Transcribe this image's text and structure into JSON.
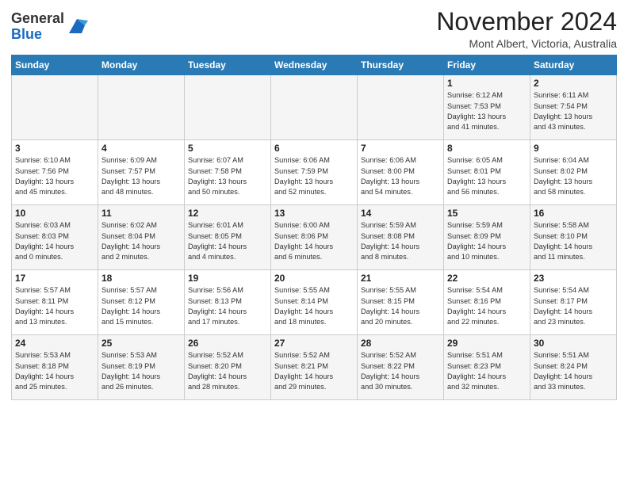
{
  "header": {
    "logo_general": "General",
    "logo_blue": "Blue",
    "month_title": "November 2024",
    "location": "Mont Albert, Victoria, Australia"
  },
  "weekdays": [
    "Sunday",
    "Monday",
    "Tuesday",
    "Wednesday",
    "Thursday",
    "Friday",
    "Saturday"
  ],
  "weeks": [
    [
      {
        "day": "",
        "info": ""
      },
      {
        "day": "",
        "info": ""
      },
      {
        "day": "",
        "info": ""
      },
      {
        "day": "",
        "info": ""
      },
      {
        "day": "",
        "info": ""
      },
      {
        "day": "1",
        "info": "Sunrise: 6:12 AM\nSunset: 7:53 PM\nDaylight: 13 hours\nand 41 minutes."
      },
      {
        "day": "2",
        "info": "Sunrise: 6:11 AM\nSunset: 7:54 PM\nDaylight: 13 hours\nand 43 minutes."
      }
    ],
    [
      {
        "day": "3",
        "info": "Sunrise: 6:10 AM\nSunset: 7:56 PM\nDaylight: 13 hours\nand 45 minutes."
      },
      {
        "day": "4",
        "info": "Sunrise: 6:09 AM\nSunset: 7:57 PM\nDaylight: 13 hours\nand 48 minutes."
      },
      {
        "day": "5",
        "info": "Sunrise: 6:07 AM\nSunset: 7:58 PM\nDaylight: 13 hours\nand 50 minutes."
      },
      {
        "day": "6",
        "info": "Sunrise: 6:06 AM\nSunset: 7:59 PM\nDaylight: 13 hours\nand 52 minutes."
      },
      {
        "day": "7",
        "info": "Sunrise: 6:06 AM\nSunset: 8:00 PM\nDaylight: 13 hours\nand 54 minutes."
      },
      {
        "day": "8",
        "info": "Sunrise: 6:05 AM\nSunset: 8:01 PM\nDaylight: 13 hours\nand 56 minutes."
      },
      {
        "day": "9",
        "info": "Sunrise: 6:04 AM\nSunset: 8:02 PM\nDaylight: 13 hours\nand 58 minutes."
      }
    ],
    [
      {
        "day": "10",
        "info": "Sunrise: 6:03 AM\nSunset: 8:03 PM\nDaylight: 14 hours\nand 0 minutes."
      },
      {
        "day": "11",
        "info": "Sunrise: 6:02 AM\nSunset: 8:04 PM\nDaylight: 14 hours\nand 2 minutes."
      },
      {
        "day": "12",
        "info": "Sunrise: 6:01 AM\nSunset: 8:05 PM\nDaylight: 14 hours\nand 4 minutes."
      },
      {
        "day": "13",
        "info": "Sunrise: 6:00 AM\nSunset: 8:06 PM\nDaylight: 14 hours\nand 6 minutes."
      },
      {
        "day": "14",
        "info": "Sunrise: 5:59 AM\nSunset: 8:08 PM\nDaylight: 14 hours\nand 8 minutes."
      },
      {
        "day": "15",
        "info": "Sunrise: 5:59 AM\nSunset: 8:09 PM\nDaylight: 14 hours\nand 10 minutes."
      },
      {
        "day": "16",
        "info": "Sunrise: 5:58 AM\nSunset: 8:10 PM\nDaylight: 14 hours\nand 11 minutes."
      }
    ],
    [
      {
        "day": "17",
        "info": "Sunrise: 5:57 AM\nSunset: 8:11 PM\nDaylight: 14 hours\nand 13 minutes."
      },
      {
        "day": "18",
        "info": "Sunrise: 5:57 AM\nSunset: 8:12 PM\nDaylight: 14 hours\nand 15 minutes."
      },
      {
        "day": "19",
        "info": "Sunrise: 5:56 AM\nSunset: 8:13 PM\nDaylight: 14 hours\nand 17 minutes."
      },
      {
        "day": "20",
        "info": "Sunrise: 5:55 AM\nSunset: 8:14 PM\nDaylight: 14 hours\nand 18 minutes."
      },
      {
        "day": "21",
        "info": "Sunrise: 5:55 AM\nSunset: 8:15 PM\nDaylight: 14 hours\nand 20 minutes."
      },
      {
        "day": "22",
        "info": "Sunrise: 5:54 AM\nSunset: 8:16 PM\nDaylight: 14 hours\nand 22 minutes."
      },
      {
        "day": "23",
        "info": "Sunrise: 5:54 AM\nSunset: 8:17 PM\nDaylight: 14 hours\nand 23 minutes."
      }
    ],
    [
      {
        "day": "24",
        "info": "Sunrise: 5:53 AM\nSunset: 8:18 PM\nDaylight: 14 hours\nand 25 minutes."
      },
      {
        "day": "25",
        "info": "Sunrise: 5:53 AM\nSunset: 8:19 PM\nDaylight: 14 hours\nand 26 minutes."
      },
      {
        "day": "26",
        "info": "Sunrise: 5:52 AM\nSunset: 8:20 PM\nDaylight: 14 hours\nand 28 minutes."
      },
      {
        "day": "27",
        "info": "Sunrise: 5:52 AM\nSunset: 8:21 PM\nDaylight: 14 hours\nand 29 minutes."
      },
      {
        "day": "28",
        "info": "Sunrise: 5:52 AM\nSunset: 8:22 PM\nDaylight: 14 hours\nand 30 minutes."
      },
      {
        "day": "29",
        "info": "Sunrise: 5:51 AM\nSunset: 8:23 PM\nDaylight: 14 hours\nand 32 minutes."
      },
      {
        "day": "30",
        "info": "Sunrise: 5:51 AM\nSunset: 8:24 PM\nDaylight: 14 hours\nand 33 minutes."
      }
    ]
  ]
}
